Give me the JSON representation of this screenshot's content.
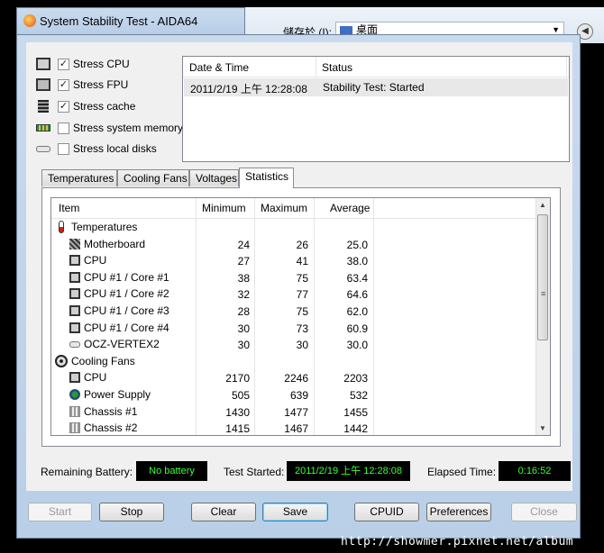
{
  "window": {
    "title": "System Stability Test - AIDA64"
  },
  "background_dialog": {
    "save_in_label": "儲存於 (I):",
    "location": "桌面"
  },
  "stress_options": [
    {
      "label": "Stress CPU",
      "checked": true,
      "mark": "✓",
      "icon": "cpu-icon"
    },
    {
      "label": "Stress FPU",
      "checked": true,
      "mark": "✓",
      "icon": "fpu-icon"
    },
    {
      "label": "Stress cache",
      "checked": true,
      "mark": "✓",
      "icon": "cache-icon"
    },
    {
      "label": "Stress system memory",
      "checked": false,
      "mark": "",
      "icon": "memory-icon"
    },
    {
      "label": "Stress local disks",
      "checked": false,
      "mark": "",
      "icon": "disk-icon"
    }
  ],
  "log": {
    "headers": [
      "Date & Time",
      "Status"
    ],
    "rows": [
      {
        "datetime": "2011/2/19 上午 12:28:08",
        "status": "Stability Test: Started"
      }
    ]
  },
  "tabs": [
    "Temperatures",
    "Cooling Fans",
    "Voltages",
    "Statistics"
  ],
  "active_tab": "Statistics",
  "grid": {
    "headers": [
      "Item",
      "Minimum",
      "Maximum",
      "Average"
    ],
    "rows": [
      {
        "type": "group",
        "name": "Temperatures",
        "icon": "thermometer-icon"
      },
      {
        "type": "item",
        "name": "Motherboard",
        "icon": "motherboard-icon",
        "min": "24",
        "max": "26",
        "avg": "25.0"
      },
      {
        "type": "item",
        "name": "CPU",
        "icon": "cpu-icon",
        "min": "27",
        "max": "41",
        "avg": "38.0"
      },
      {
        "type": "item",
        "name": "CPU #1 / Core #1",
        "icon": "cpu-icon",
        "min": "38",
        "max": "75",
        "avg": "63.4"
      },
      {
        "type": "item",
        "name": "CPU #1 / Core #2",
        "icon": "cpu-icon",
        "min": "32",
        "max": "77",
        "avg": "64.6"
      },
      {
        "type": "item",
        "name": "CPU #1 / Core #3",
        "icon": "cpu-icon",
        "min": "28",
        "max": "75",
        "avg": "62.0"
      },
      {
        "type": "item",
        "name": "CPU #1 / Core #4",
        "icon": "cpu-icon",
        "min": "30",
        "max": "73",
        "avg": "60.9"
      },
      {
        "type": "item",
        "name": "OCZ-VERTEX2",
        "icon": "disk-icon",
        "min": "30",
        "max": "30",
        "avg": "30.0"
      },
      {
        "type": "group",
        "name": "Cooling Fans",
        "icon": "fan-icon"
      },
      {
        "type": "item",
        "name": "CPU",
        "icon": "cpu-icon",
        "min": "2170",
        "max": "2246",
        "avg": "2203"
      },
      {
        "type": "item",
        "name": "Power Supply",
        "icon": "power-supply-icon",
        "min": "505",
        "max": "639",
        "avg": "532"
      },
      {
        "type": "item",
        "name": "Chassis #1",
        "icon": "chassis-icon",
        "min": "1430",
        "max": "1477",
        "avg": "1455"
      },
      {
        "type": "item",
        "name": "Chassis #2",
        "icon": "chassis-icon",
        "min": "1415",
        "max": "1467",
        "avg": "1442"
      }
    ]
  },
  "status": {
    "battery_label": "Remaining Battery:",
    "battery_value": "No battery",
    "started_label": "Test Started:",
    "started_value": "2011/2/19 上午 12:28:08",
    "elapsed_label": "Elapsed Time:",
    "elapsed_value": "0:16:52",
    "lcd_color": "#39ff39"
  },
  "buttons": {
    "start": "Start",
    "stop": "Stop",
    "clear": "Clear",
    "save": "Save",
    "cpuid": "CPUID",
    "preferences": "Preferences",
    "close": "Close"
  },
  "watermark": "http://showmer.pixnet.net/album"
}
